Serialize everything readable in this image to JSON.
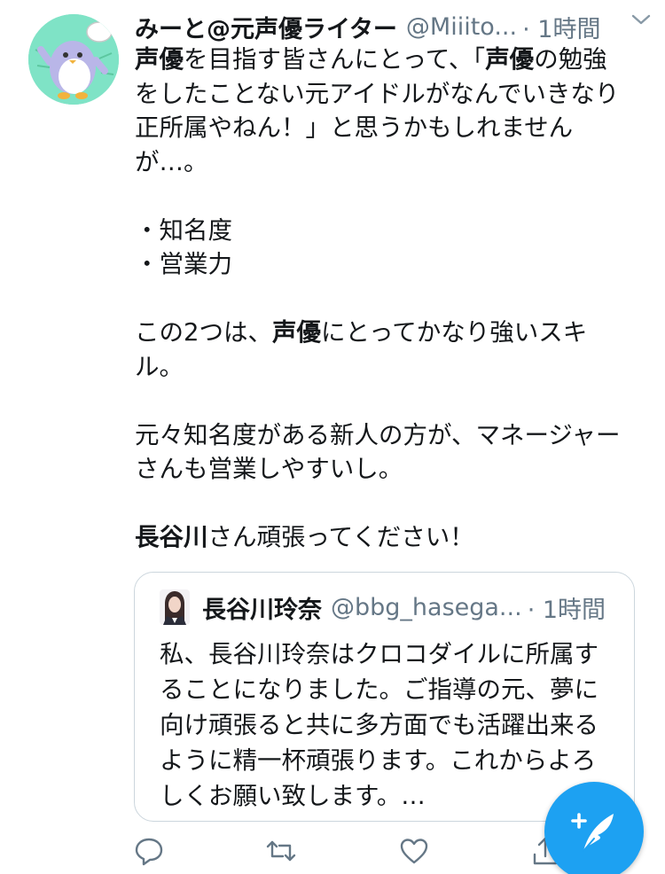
{
  "tweet": {
    "display_name": "みーと@元声優ライター",
    "handle": "@Miiito...",
    "time": "· 1時間",
    "body_lines": [
      [
        {
          "t": "声優",
          "b": true
        },
        {
          "t": "を目指す皆さんにとって、「"
        },
        {
          "t": "声優",
          "b": true
        },
        {
          "t": "の勉強"
        }
      ],
      [
        {
          "t": "をしたことない元アイドルがなんでいきなり"
        }
      ],
      [
        {
          "t": "正所属やねん！」と思うかもしれません"
        }
      ],
      [
        {
          "t": "が…。"
        }
      ],
      [],
      [
        {
          "t": "・知名度"
        }
      ],
      [
        {
          "t": "・営業力"
        }
      ],
      [],
      [
        {
          "t": "この2つは、"
        },
        {
          "t": "声優",
          "b": true
        },
        {
          "t": "にとってかなり強いスキ"
        }
      ],
      [
        {
          "t": "ル。"
        }
      ],
      [],
      [
        {
          "t": "元々知名度がある新人の方が、マネージャー"
        }
      ],
      [
        {
          "t": "さんも営業しやすいし。"
        }
      ],
      [],
      [
        {
          "t": "長谷川",
          "b": true
        },
        {
          "t": "さん頑張ってください！"
        }
      ]
    ]
  },
  "quoted": {
    "display_name": "長谷川玲奈",
    "handle": "@bbg_hasega...",
    "time": "· 1時間",
    "lines": [
      "私、長谷川玲奈はクロコダイルに所属す",
      "ることになりました。ご指導の元、夢に",
      "向け頑張ると共に多方面でも活躍出来る",
      "ように精一杯頑張ります。これからよろ",
      "しくお願い致します。…"
    ]
  },
  "icons": {
    "caret": "chevron-down-icon",
    "reply": "reply-icon",
    "retweet": "retweet-icon",
    "like": "heart-icon",
    "share": "share-icon",
    "compose": "compose-tweet-icon"
  },
  "colors": {
    "text": "#14171a",
    "secondary": "#657786",
    "border": "#ccd6dd",
    "accent": "#1da1f2"
  }
}
